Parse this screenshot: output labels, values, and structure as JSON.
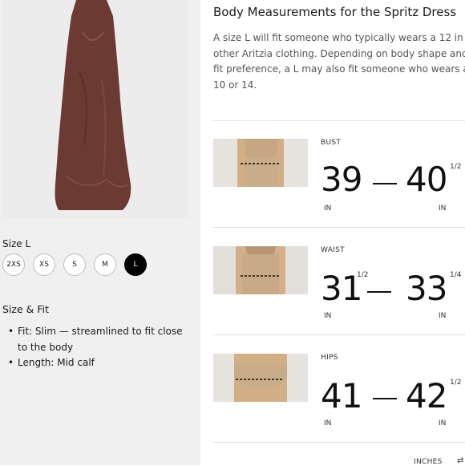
{
  "left": {
    "hero_alt": "Spritz Dress",
    "size_label": "Size L",
    "sizes": [
      "2XS",
      "XS",
      "S",
      "M",
      "L"
    ],
    "selected_size": "L",
    "fit_heading": "Size & Fit",
    "fit_items": [
      "Fit: Slim — streamlined to fit close to the body",
      "Length: Mid calf"
    ]
  },
  "right": {
    "title": "Body Measurements for the Spritz Dress",
    "description": "A size L will fit someone who typically wears a 12 in other Aritzia clothing. Depending on body shape and fit preference, a L may also fit someone who wears a 10 or 14.",
    "measurements": [
      {
        "label": "BUST",
        "low": "39",
        "low_frac": "",
        "high": "40",
        "high_frac": "1/2",
        "unit_low": "IN",
        "unit_high": "IN"
      },
      {
        "label": "WAIST",
        "low": "31",
        "low_frac": "1/2",
        "high": "33",
        "high_frac": "1/4",
        "unit_low": "IN",
        "unit_high": "IN"
      },
      {
        "label": "HIPS",
        "low": "41",
        "low_frac": "",
        "high": "42",
        "high_frac": "1/2",
        "unit_low": "IN",
        "unit_high": "IN"
      }
    ],
    "unit_toggle": "INCHES"
  },
  "colors": {
    "dress": "#6b3a33",
    "selected_chip": "#000000",
    "skin": "#cfa77e",
    "fabric": "#c8ad8a"
  }
}
